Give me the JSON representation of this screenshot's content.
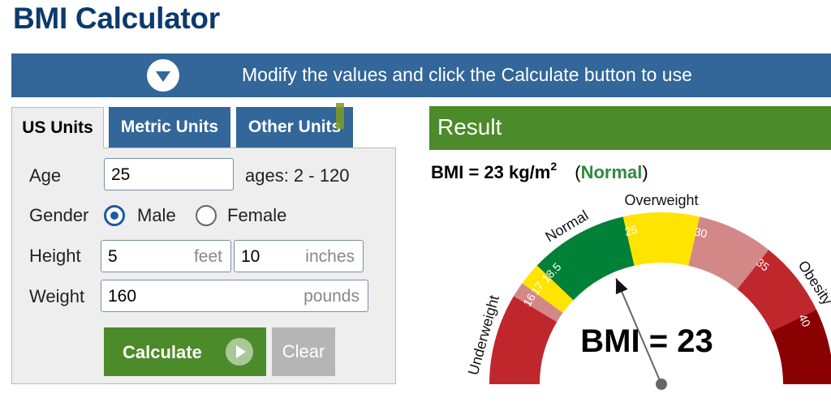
{
  "page_title": "BMI Calculator",
  "banner": {
    "icon": "chevron-down-circle-icon",
    "text": "Modify the values and click the Calculate button to use"
  },
  "tabs": [
    {
      "label": "US Units",
      "active": true
    },
    {
      "label": "Metric Units",
      "active": false
    },
    {
      "label": "Other Units",
      "active": false
    }
  ],
  "form": {
    "age": {
      "label": "Age",
      "value": "25",
      "hint": "ages: 2 - 120"
    },
    "gender": {
      "label": "Gender",
      "options": [
        "Male",
        "Female"
      ],
      "selected": "Male"
    },
    "height": {
      "label": "Height",
      "feet_value": "5",
      "feet_unit": "feet",
      "inches_value": "10",
      "inches_unit": "inches"
    },
    "weight": {
      "label": "Weight",
      "value": "160",
      "unit": "pounds"
    },
    "calculate_label": "Calculate",
    "clear_label": "Clear"
  },
  "result": {
    "header": "Result",
    "bmi_prefix": "BMI = 23 kg/m",
    "bmi_sup": "2",
    "open_paren": "(",
    "category": "Normal",
    "close_paren": ")",
    "gauge_value": 23,
    "gauge_label": "BMI = 23",
    "gauge_segments": [
      {
        "name": "Underweight",
        "from": 10,
        "to": 16,
        "color": "#c0272d"
      },
      {
        "name": "Underweight",
        "from": 16,
        "to": 17,
        "color": "#d38888"
      },
      {
        "name": "Underweight",
        "from": 17,
        "to": 18.5,
        "color": "#ffe400"
      },
      {
        "name": "Normal",
        "from": 18.5,
        "to": 25,
        "color": "#008137"
      },
      {
        "name": "Overweight",
        "from": 25,
        "to": 30,
        "color": "#ffe400"
      },
      {
        "name": "Obesity",
        "from": 30,
        "to": 35,
        "color": "#d38888"
      },
      {
        "name": "Obesity",
        "from": 35,
        "to": 40,
        "color": "#c0272d"
      },
      {
        "name": "Obesity",
        "from": 40,
        "to": 45,
        "color": "#8a0101"
      }
    ],
    "gauge_category_labels": [
      "Underweight",
      "Normal",
      "Overweight",
      "Obesity"
    ],
    "gauge_ticks": [
      "16",
      "17",
      "18.5",
      "25",
      "30",
      "35",
      "40"
    ]
  }
}
